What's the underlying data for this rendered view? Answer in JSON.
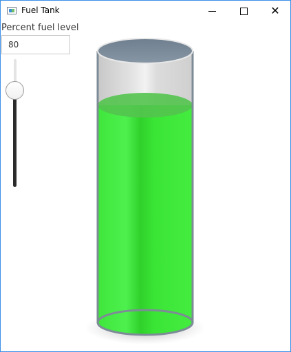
{
  "window": {
    "title": "Fuel Tank",
    "controls": {
      "minimize": "",
      "maximize": "",
      "close": "✕"
    }
  },
  "fuel": {
    "label": "Percent fuel level",
    "value": "80",
    "level_percent": 80
  },
  "colors": {
    "fuel_light": "#4ef04e",
    "fuel_mid": "#33d42b",
    "fuel_dark": "#25b81f",
    "glass": "#dcdcdc",
    "tank_top": "#7a8a99",
    "slider_fill": "#2b2b2b"
  },
  "icons": [
    "app-icon",
    "minimize-icon",
    "maximize-icon",
    "close-icon"
  ]
}
